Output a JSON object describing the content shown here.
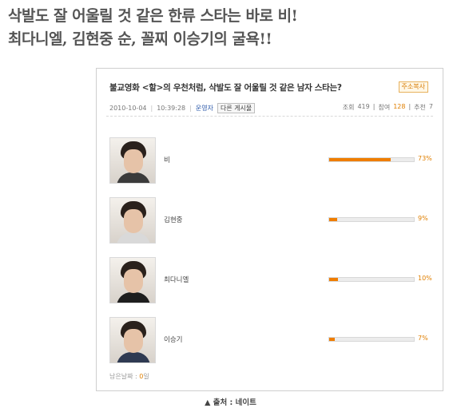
{
  "headline": {
    "line1": "삭발도 잘 어울릴 것 같은 한류 스타는 바로 비!",
    "line2": "최다니엘, 김현중 순, 꼴찌 이승기의 굴욕!!"
  },
  "poll": {
    "title": "불교영화 <할>의 우천처럼, 삭발도 잘 어울릴 것 같은 남자 스타는?",
    "copy_button": "주소복사",
    "date": "2010-10-04",
    "time": "10:39:28",
    "author": "운영자",
    "other_posts_button": "다른 게시물",
    "views_label": "조회",
    "views": "419",
    "participants_label": "참여",
    "participants": "128",
    "recommend_label": "추천",
    "recommend": "7",
    "options": [
      {
        "name": "비",
        "percent_label": "73%",
        "percent": 73
      },
      {
        "name": "김현중",
        "percent_label": "9%",
        "percent": 9
      },
      {
        "name": "최다니엘",
        "percent_label": "10%",
        "percent": 10
      },
      {
        "name": "이승기",
        "percent_label": "7%",
        "percent": 7
      }
    ],
    "remaining_days_label": "남은날짜 :",
    "remaining_days": "0",
    "remaining_days_unit": "일"
  },
  "caption": "▲ 출처 : 네이트",
  "colors": {
    "accent": "#ef7d00",
    "headline": "#555555"
  }
}
